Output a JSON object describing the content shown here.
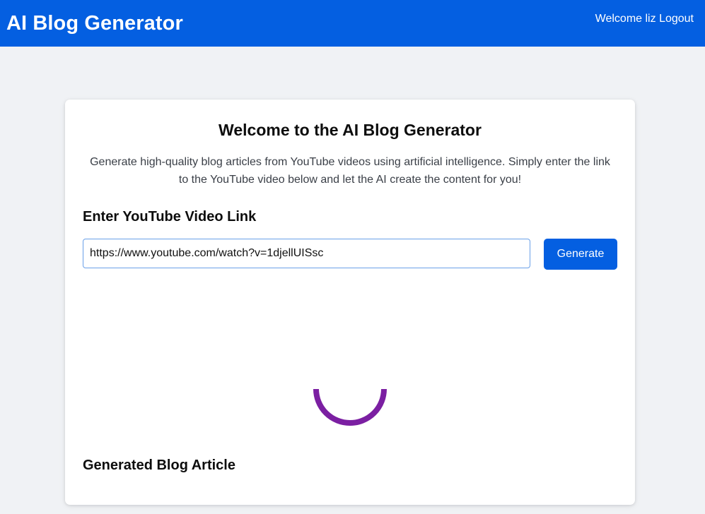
{
  "header": {
    "brand": "AI Blog Generator",
    "welcome": "Welcome liz",
    "logout_label": "Logout",
    "background_color": "#045fe1"
  },
  "main": {
    "title": "Welcome to the AI Blog Generator",
    "description": "Generate high-quality blog articles from YouTube videos using artificial intelligence. Simply enter the link to the YouTube video below and let the AI create the content for you!",
    "input_section_label": "Enter YouTube Video Link",
    "link_input_value": "https://www.youtube.com/watch?v=1djellUISsc",
    "generate_label": "Generate",
    "loading_icon": "loading-spinner-icon",
    "loading_color": "#7b1fa2",
    "result_section_label": "Generated Blog Article"
  }
}
